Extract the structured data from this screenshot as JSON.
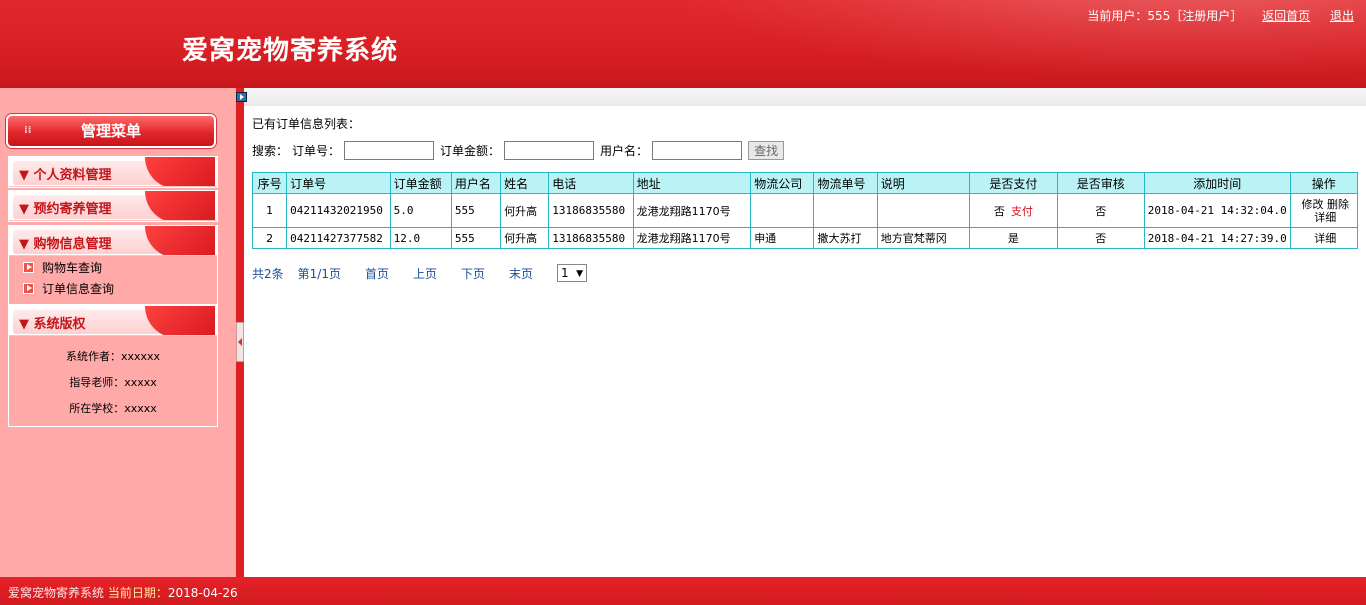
{
  "header": {
    "title": "爱窝宠物寄养系统",
    "current_user_label": "当前用户：555［注册用户］",
    "home_link": "返回首页",
    "logout_link": "退出"
  },
  "sidebar": {
    "title": "管理菜单",
    "groups": [
      {
        "label": "▼ 个人资料管理"
      },
      {
        "label": "▼ 预约寄养管理"
      },
      {
        "label": "▼ 购物信息管理",
        "items": [
          "购物车查询",
          "订单信息查询"
        ]
      },
      {
        "label": "▼   系统版权"
      }
    ],
    "copyright": {
      "author": "系统作者：xxxxxx",
      "teacher": "指导老师：xxxxx",
      "school": "所在学校：xxxxx"
    }
  },
  "main": {
    "heading": "已有订单信息列表：",
    "search": {
      "label": "搜索：",
      "order_no_label": "订单号：",
      "amount_label": "订单金额：",
      "username_label": "用户名：",
      "button": "查找"
    },
    "table": {
      "columns": [
        "序号",
        "订单号",
        "订单金额",
        "用户名",
        "姓名",
        "电话",
        "地址",
        "物流公司",
        "物流单号",
        "说明",
        "是否支付",
        "是否审核",
        "添加时间",
        "操作"
      ],
      "rows": [
        {
          "no": "1",
          "order_no": "04211432021950",
          "amount": "5.0",
          "username": "555",
          "name": "何升高",
          "phone": "13186835580",
          "address": "龙港龙翔路1170号",
          "logistics": "",
          "tracking": "",
          "note": "",
          "paid": "否",
          "pay_action": "支付",
          "reviewed": "否",
          "added": "2018-04-21 14:32:04.0",
          "ops": [
            "修改",
            "删除",
            "详细"
          ]
        },
        {
          "no": "2",
          "order_no": "04211427377582",
          "amount": "12.0",
          "username": "555",
          "name": "何升高",
          "phone": "13186835580",
          "address": "龙港龙翔路1170号",
          "logistics": "申通",
          "tracking": "撒大苏打",
          "note": "地方官梵蒂冈",
          "paid": "是",
          "reviewed": "否",
          "added": "2018-04-21 14:27:39.0",
          "ops": [
            "详细"
          ]
        }
      ]
    },
    "pager": {
      "total": "共2条",
      "page": "第1/1页",
      "first": "首页",
      "prev": "上页",
      "next": "下页",
      "last": "末页",
      "select_value": "1"
    }
  },
  "footer": {
    "system_name": "爱窝宠物寄养系统",
    "date_label": "当前日期：",
    "date": "2018-04-26"
  }
}
